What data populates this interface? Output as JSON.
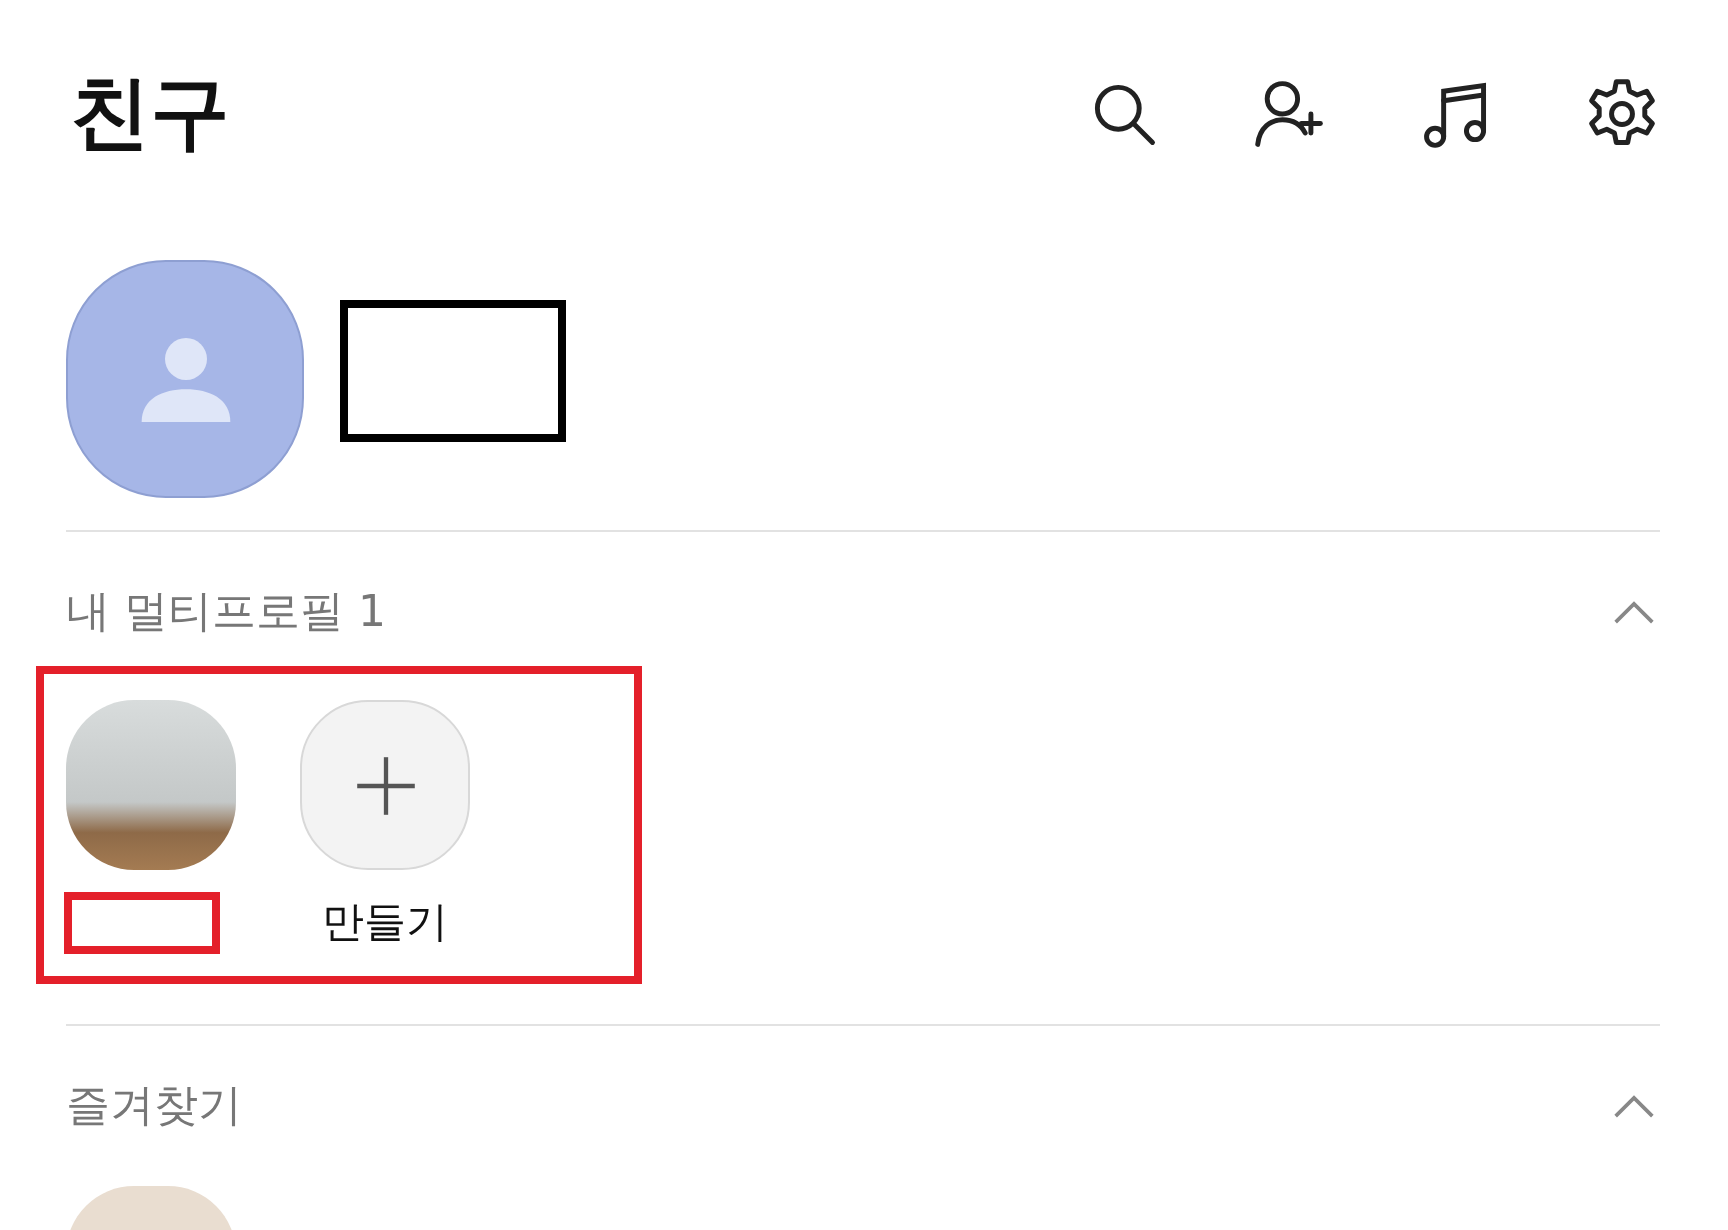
{
  "header": {
    "title": "친구"
  },
  "profile": {
    "redacted": true
  },
  "sections": [
    {
      "title": "내 멀티프로필 1",
      "expanded": true,
      "highlighted": true,
      "items": [
        {
          "kind": "photo",
          "redacted": true
        },
        {
          "kind": "create",
          "label": "만들기"
        }
      ]
    },
    {
      "title": "즐겨찾기",
      "expanded": true,
      "highlighted": false,
      "items": [
        {
          "kind": "avatar-peek"
        }
      ]
    }
  ]
}
